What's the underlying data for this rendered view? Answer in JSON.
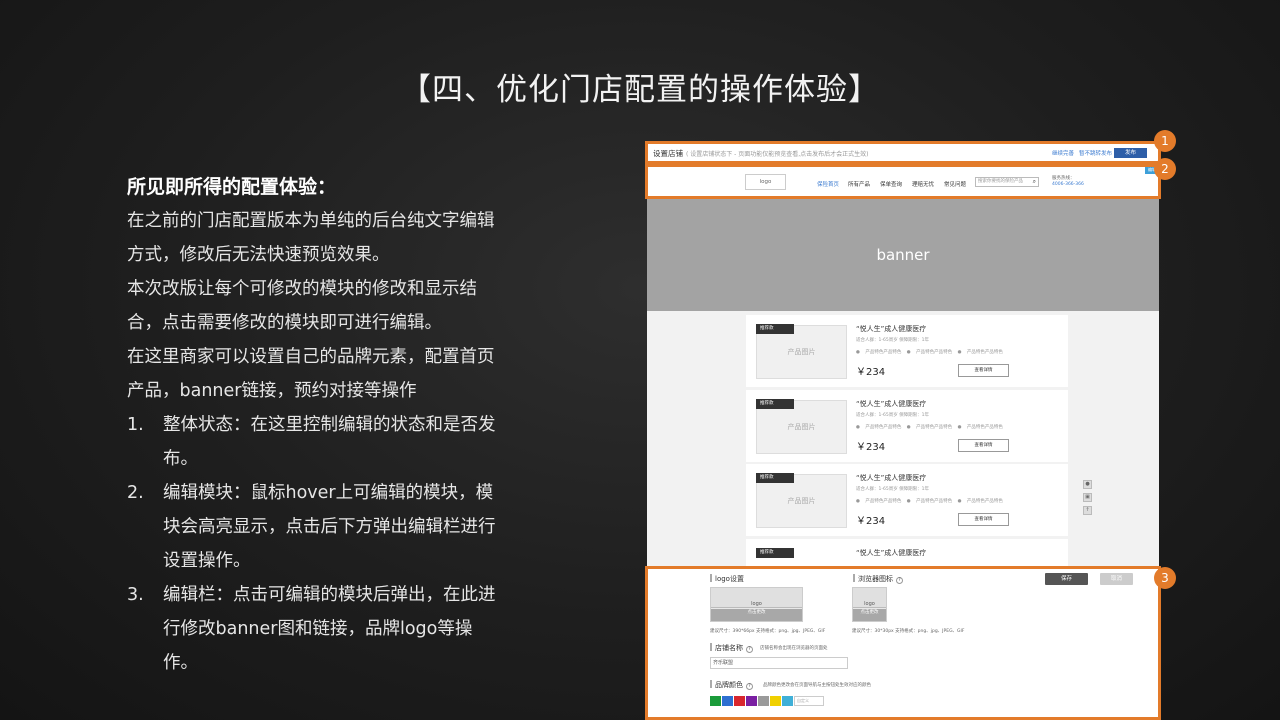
{
  "slide": {
    "title": "【四、优化门店配置的操作体验】"
  },
  "description": {
    "heading": "所见即所得的配置体验：",
    "paragraphs": [
      "在之前的门店配置版本为单纯的后台纯文字编辑方式，修改后无法快速预览效果。",
      "本次改版让每个可修改的模块的修改和显示结合，点击需要修改的模块即可进行编辑。",
      "在这里商家可以设置自己的品牌元素，配置首页产品，banner链接，预约对接等操作"
    ],
    "items": [
      {
        "num": "1.",
        "text": "整体状态：在这里控制编辑的状态和是否发布。"
      },
      {
        "num": "2.",
        "text": "编辑模块：鼠标hover上可编辑的模块，模块会高亮显示，点击后下方弹出编辑栏进行设置操作。"
      },
      {
        "num": "3.",
        "text": "编辑栏：点击可编辑的模块后弹出，在此进行修改banner图和链接，品牌logo等操作。"
      }
    ]
  },
  "mockup": {
    "topbar": {
      "title": "设置店铺",
      "subtitle": "( 设置店铺状态下 - 页面功能仅能预览查看,点击发布后才会正式生效)",
      "action1": "继续完善",
      "action2": "暂不跳转发布",
      "publish": "发布"
    },
    "navbar": {
      "logo": "logo",
      "items": [
        "保险首页",
        "所有产品",
        "保单查询",
        "理赔无忧",
        "常见问题"
      ],
      "search_placeholder": "搜索你要找的保险产品",
      "hotline_label": "服务热线：",
      "hotline": "4006-366-366",
      "edit_tag": "编辑"
    },
    "banner": "banner",
    "products": [
      {
        "tag": "推荐款",
        "image": "产品图片",
        "name": "“悦人生”成人健康医疗",
        "meta": "适合人群：1-65周岁   保障期限：1年",
        "features": "● 产品特色产品特色  ● 产品特色产品特色  ● 产品特色产品特色",
        "price": "￥234",
        "button": "查看详情"
      },
      {
        "tag": "推荐款",
        "image": "产品图片",
        "name": "“悦人生”成人健康医疗",
        "meta": "适合人群：1-65周岁   保障期限：1年",
        "features": "● 产品特色产品特色  ● 产品特色产品特色  ● 产品特色产品特色",
        "price": "￥234",
        "button": "查看详情"
      },
      {
        "tag": "推荐款",
        "image": "产品图片",
        "name": "“悦人生”成人健康医疗",
        "meta": "适合人群：1-65周岁   保障期限：1年",
        "features": "● 产品特色产品特色  ● 产品特色产品特色  ● 产品特色产品特色",
        "price": "￥234",
        "button": "查看详情"
      },
      {
        "tag": "推荐款",
        "image": "",
        "name": "“悦人生”成人健康医疗",
        "meta": "",
        "features": "",
        "price": "",
        "button": ""
      }
    ],
    "sidetools": [
      "●",
      "▣",
      "↑"
    ],
    "editpanel": {
      "logo_title": "logo设置",
      "logo_preview": "logo",
      "logo_upload": "点击更改",
      "logo_hint": "建议尺寸：390*66px  支持格式：png、jpg、JPEG、GIF",
      "favicon_title": "浏览器图标",
      "favicon_help": "?",
      "favicon_preview": "logo",
      "favicon_upload": "点击更改",
      "favicon_hint": "建议尺寸：30*30px  支持格式：png、jpg、JPEG、GIF",
      "save": "保存",
      "cancel": "取消",
      "name_title": "店铺名称",
      "name_help": "?",
      "name_hint": "店铺名称会出现在浏览器的页面处",
      "name_value": "齐乐联盟",
      "color_title": "品牌颜色",
      "color_help": "?",
      "color_hint": "品牌颜色更改会在页面导航与主按钮处生效对应的颜色",
      "swatches": [
        "#1a9b3a",
        "#2d6fd1",
        "#d8262e",
        "#7a1fa2",
        "#9a9a9a",
        "#f0d000",
        "#3fb0d8"
      ],
      "custom_placeholder": "自定义"
    },
    "badges": [
      "1",
      "2",
      "3"
    ]
  },
  "colors": {
    "highlight": "#e37b2a",
    "link": "#3b7bd0",
    "publish": "#2d5ea8"
  }
}
